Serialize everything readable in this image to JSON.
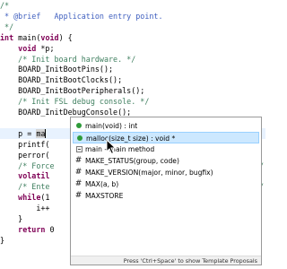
{
  "editor": {
    "lines": [
      {
        "cls": "cm",
        "text": "/*"
      },
      {
        "cls": "cm-doc",
        "text": " * @brief   Application entry point."
      },
      {
        "cls": "cm",
        "text": " */"
      },
      {
        "cls": "code",
        "parts": [
          {
            "t": "int",
            "k": "kw"
          },
          {
            "t": " main(",
            "k": ""
          },
          {
            "t": "void",
            "k": "kw"
          },
          {
            "t": ") {",
            "k": ""
          }
        ]
      },
      {
        "cls": "code",
        "parts": [
          {
            "t": "    ",
            "k": ""
          },
          {
            "t": "void",
            "k": "kw"
          },
          {
            "t": " *p;",
            "k": ""
          }
        ]
      },
      {
        "cls": "cm",
        "text": "    /* Init board hardware. */"
      },
      {
        "cls": "code",
        "text": "    BOARD_InitBootPins();"
      },
      {
        "cls": "code",
        "text": "    BOARD_InitBootClocks();"
      },
      {
        "cls": "code",
        "text": "    BOARD_InitBootPeripherals();"
      },
      {
        "cls": "cm",
        "text": "    /* Init FSL debug console. */"
      },
      {
        "cls": "code",
        "text": "    BOARD_InitDebugConsole();"
      },
      {
        "cls": "code",
        "text": ""
      },
      {
        "cls": "current",
        "text": "    p = ma"
      },
      {
        "cls": "code",
        "text": "    printf("
      },
      {
        "cls": "code",
        "text": "    perror("
      },
      {
        "cls": "cm",
        "text": "    /* Force"
      },
      {
        "cls": "kw",
        "text": "    volatil"
      },
      {
        "cls": "cm",
        "text": "    /* Ente"
      },
      {
        "cls": "code",
        "parts": [
          {
            "t": "    ",
            "k": ""
          },
          {
            "t": "while",
            "k": "kw"
          },
          {
            "t": "(1",
            "k": ""
          }
        ]
      },
      {
        "cls": "code",
        "text": "        i++"
      },
      {
        "cls": "code",
        "text": "    }"
      },
      {
        "cls": "code",
        "parts": [
          {
            "t": "    ",
            "k": ""
          },
          {
            "t": "return",
            "k": "kw"
          },
          {
            "t": " 0",
            "k": ""
          }
        ]
      },
      {
        "cls": "code",
        "text": "}"
      }
    ],
    "right_edge": [
      {
        "line": 15,
        "text": "*/"
      },
      {
        "line": 17,
        "text": "*/"
      }
    ]
  },
  "completion": {
    "proposals": [
      {
        "icon": "dot",
        "icon_name": "function-icon",
        "label": "main(void) : int",
        "selected": false
      },
      {
        "icon": "dot",
        "icon_name": "function-icon",
        "label": "malloc(size_t size) : void *",
        "selected": true
      },
      {
        "icon": "sq",
        "icon_name": "template-icon",
        "label": "main - main method",
        "selected": false
      },
      {
        "icon": "hash",
        "icon_name": "macro-icon",
        "label": "MAKE_STATUS(group, code)",
        "selected": false
      },
      {
        "icon": "hash",
        "icon_name": "macro-icon",
        "label": "MAKE_VERSION(major, minor, bugfix)",
        "selected": false
      },
      {
        "icon": "hash",
        "icon_name": "macro-icon",
        "label": "MAX(a, b)",
        "selected": false
      },
      {
        "icon": "hash",
        "icon_name": "macro-icon",
        "label": "MAXSTORE",
        "selected": false
      }
    ],
    "footer": "Press 'Ctrl+Space' to show Template Proposals"
  },
  "colors": {
    "keyword": "#7f0055",
    "comment": "#3f7f5f",
    "doc_comment": "#3f5fbf",
    "selection": "#cce8ff",
    "current_line": "#e8f2fe",
    "function_icon": "#2e9b3a"
  }
}
